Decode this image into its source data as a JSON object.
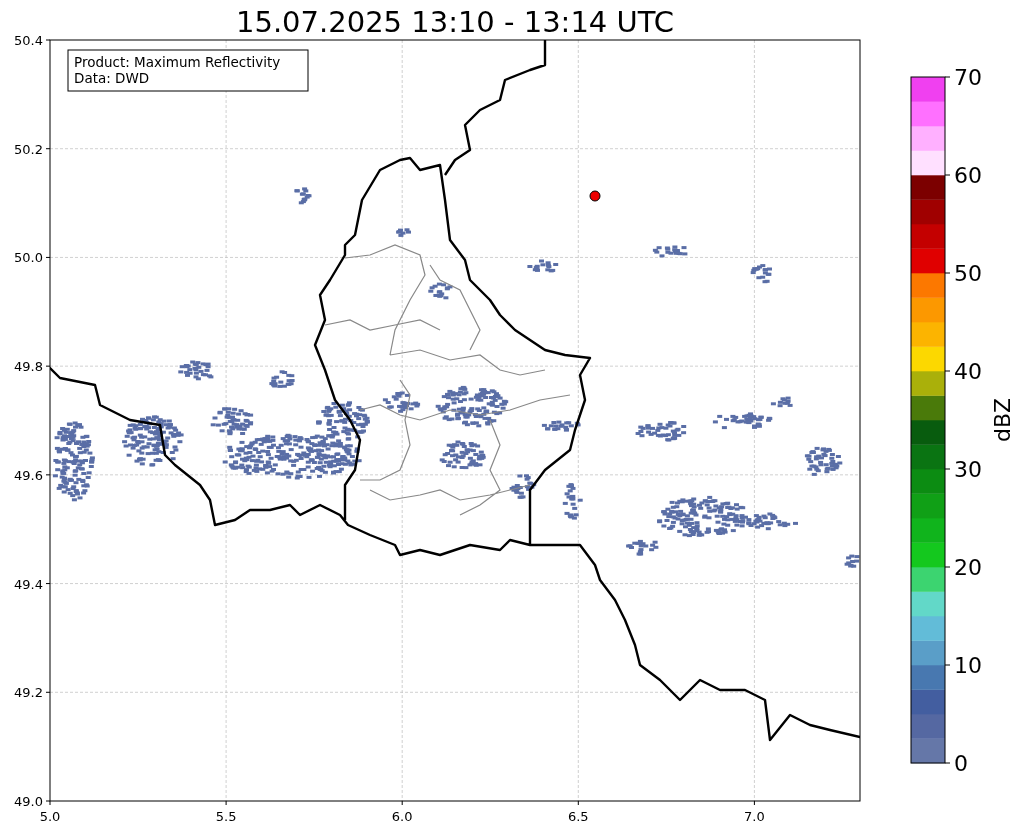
{
  "title": "15.07.2025 13:10 - 13:14 UTC",
  "info_box": [
    "Product: Maximum Reflectivity",
    "Data: DWD"
  ],
  "map": {
    "x_ticks": [
      "5.0",
      "5.5",
      "6.0",
      "6.5",
      "7.0"
    ],
    "y_ticks": [
      "50.4",
      "50.2",
      "50.0",
      "49.8",
      "49.6",
      "49.4",
      "49.2",
      "49.0"
    ]
  },
  "colorbar": {
    "label": "dBZ",
    "tick_labels": [
      "70",
      "60",
      "50",
      "40",
      "30",
      "20",
      "10",
      "0"
    ],
    "segments": [
      {
        "color": "#6577a8"
      },
      {
        "color": "#5568a2"
      },
      {
        "color": "#435ea0"
      },
      {
        "color": "#4878b0"
      },
      {
        "color": "#5a9ec8"
      },
      {
        "color": "#62bcd8"
      },
      {
        "color": "#62d8c8"
      },
      {
        "color": "#3cd470"
      },
      {
        "color": "#14c81e"
      },
      {
        "color": "#10b41c"
      },
      {
        "color": "#10a016"
      },
      {
        "color": "#0c8c12"
      },
      {
        "color": "#0a7412"
      },
      {
        "color": "#085c0e"
      },
      {
        "color": "#4a7a0a"
      },
      {
        "color": "#aab00a"
      },
      {
        "color": "#fcd800"
      },
      {
        "color": "#fcb400"
      },
      {
        "color": "#fc9800"
      },
      {
        "color": "#fc7800"
      },
      {
        "color": "#e00000"
      },
      {
        "color": "#c40000"
      },
      {
        "color": "#a00000"
      },
      {
        "color": "#7c0000"
      },
      {
        "color": "#ffe0ff"
      },
      {
        "color": "#ffb0ff"
      },
      {
        "color": "#ff70ff"
      },
      {
        "color": "#f040f0"
      }
    ]
  }
}
